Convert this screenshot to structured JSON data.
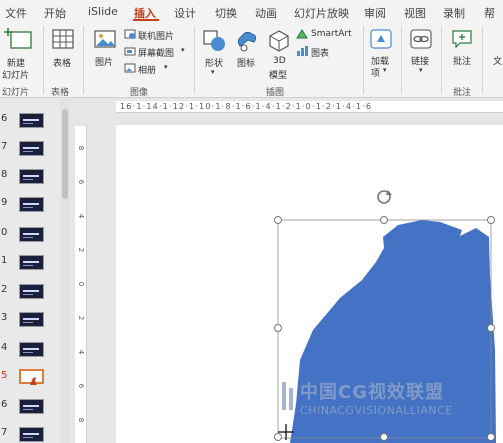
{
  "menu": {
    "items": [
      {
        "label": "文件",
        "name": "menu-file"
      },
      {
        "label": "开始",
        "name": "menu-home"
      },
      {
        "label": "iSlide",
        "name": "menu-islide"
      },
      {
        "label": "插入",
        "name": "menu-insert",
        "active": true
      },
      {
        "label": "设计",
        "name": "menu-design"
      },
      {
        "label": "切换",
        "name": "menu-transitions"
      },
      {
        "label": "动画",
        "name": "menu-animations"
      },
      {
        "label": "幻灯片放映",
        "name": "menu-slideshow"
      },
      {
        "label": "审阅",
        "name": "menu-review"
      },
      {
        "label": "视图",
        "name": "menu-view"
      },
      {
        "label": "录制",
        "name": "menu-record"
      },
      {
        "label": "帮",
        "name": "menu-help"
      }
    ]
  },
  "ribbon": {
    "new_slide_line1": "新建",
    "new_slide_line2": "幻灯片",
    "table": "表格",
    "picture": "图片",
    "online_pictures": "联机图片",
    "screenshot": "屏幕截图",
    "album": "相册",
    "shapes": "形状",
    "icons": "图标",
    "model_3d_line1": "3D",
    "model_3d_line2": "模型",
    "smartart": "SmartArt",
    "chart": "图表",
    "addins_line1": "加载",
    "addins_line2": "项",
    "link": "链接",
    "comment": "批注",
    "text": "文",
    "groups": {
      "slides": "幻灯片",
      "tables": "表格",
      "images": "图像",
      "illustrations": "插图",
      "comments": "批注"
    }
  },
  "thumbnails": {
    "numbers": [
      "6",
      "7",
      "8",
      "9",
      "0",
      "1",
      "2",
      "3",
      "4",
      "5",
      "6",
      "7"
    ],
    "selected_number": "5"
  },
  "ruler": {
    "horizontal": "16·1·14·1·12·1·10·1·8·1·6·1·4·1·2·1·0·1·2·1·4·1·6",
    "vertical": [
      "8",
      "6",
      "4",
      "2",
      "0",
      "2",
      "4",
      "6",
      "8"
    ]
  },
  "watermark": {
    "main": "中国CG视效联盟",
    "sub": "CHINACGVISIONALLIANCE"
  },
  "colors": {
    "accent": "#c43e1c",
    "shape_fill": "#4472c4",
    "thumb_selected_border": "#e07a3b"
  }
}
